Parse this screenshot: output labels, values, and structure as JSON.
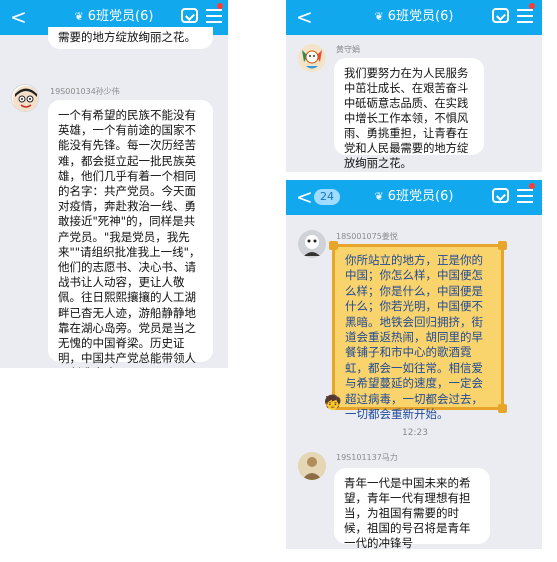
{
  "colors": {
    "header": "#12a8ee",
    "chat_bg": "#eaecf1",
    "gold_bubble": "#f9d36b",
    "gold_border": "#e7a62b",
    "gold_text": "#1f4a99"
  },
  "icons": {
    "back": "chevron-left-icon",
    "title_leaf": "leaf-icon",
    "group": "group-check-icon",
    "menu": "menu-icon"
  },
  "screens": [
    {
      "header": {
        "back": "<",
        "title": "6班党员(6)"
      },
      "top_fragment": "需要的地方绽放绚丽之花。",
      "message": {
        "sender": "19S001034孙少伟",
        "text": "一个有希望的民族不能没有英雄，一个有前途的国家不能没有先锋。每一次历经苦难，都会挺立起一批民族英雄，他们几乎有着一个相同的名字：共产党员。今天面对疫情，奔赴救治一线、勇敢接近\"死神\"的，同样是共产党员。\"我是党员，我先来\"\"请组织批准我上一线\"，他们的志愿书、决心书、请战书让人动容，更让人敬佩。往日熙熙攘攘的人工湖畔已杳无人迹，游船静静地靠在湖心岛旁。党员是当之无愧的中国脊梁。历史证明，中国共产党总能带领人民创造奇迹。"
      }
    },
    {
      "header": {
        "back": "<",
        "title": "6班党员(6)"
      },
      "message": {
        "sender": "黄守娟",
        "text": "我们要努力在为人民服务中茁壮成长、在艰苦奋斗中砥砺意志品质、在实践中增长工作本领，不惧风雨、勇挑重担，让青春在党和人民最需要的地方绽放绚丽之花。"
      }
    },
    {
      "header": {
        "back": "<",
        "badge": "24",
        "title": "6班党员(6)"
      },
      "message1": {
        "sender": "18S001075姜悦",
        "text": "你所站立的地方，正是你的中国；你怎么样，中国便怎么样；你是什么，中国便是什么；你若光明，中国便不黑暗。地铁会回归拥挤，街道会重返热闹，胡同里的早餐铺子和市中心的歌酒霓虹，都会一如往常。相信爱与希望蔓延的速度，一定会超过病毒，一切都会过去，一切都会重新开始。"
      },
      "time": "12:23",
      "message2": {
        "sender": "19S101137马力",
        "text": "青年一代是中国未来的希望，青年一代有理想有担当，为祖国有需要的时候，祖国的号召将是青年一代的冲锋号"
      }
    }
  ]
}
